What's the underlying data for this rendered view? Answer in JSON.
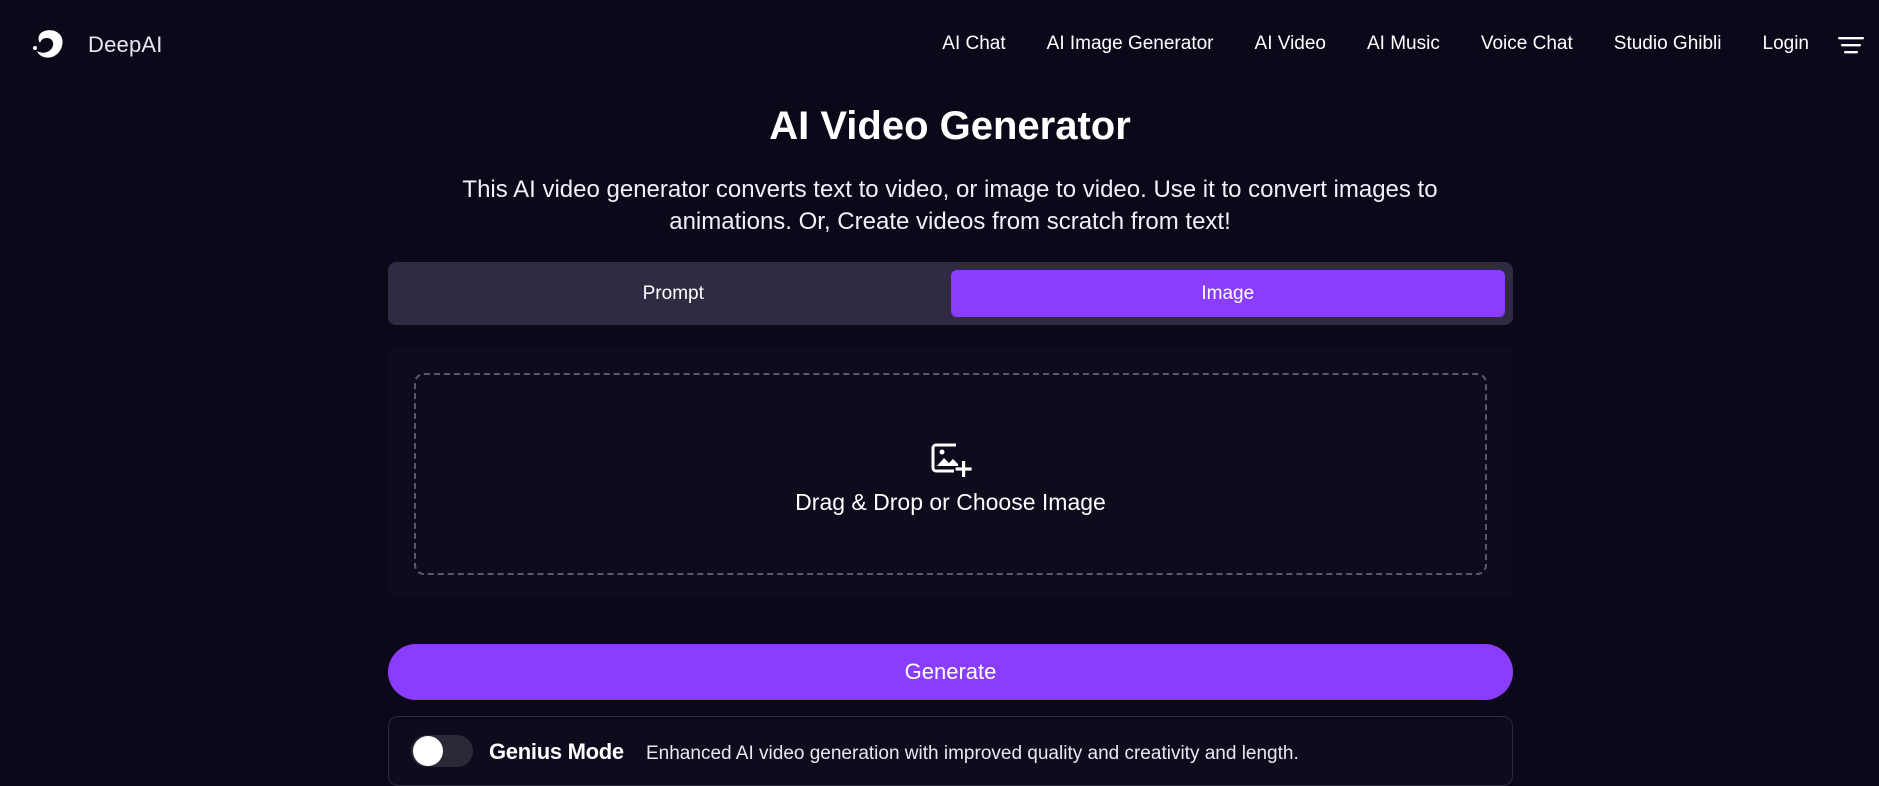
{
  "header": {
    "brand_name": "DeepAI",
    "nav_items": [
      {
        "label": "AI Chat"
      },
      {
        "label": "AI Image Generator"
      },
      {
        "label": "AI Video"
      },
      {
        "label": "AI Music"
      },
      {
        "label": "Voice Chat"
      },
      {
        "label": "Studio Ghibli"
      },
      {
        "label": "Login"
      }
    ],
    "menu_icon": "hamburger-menu-icon"
  },
  "main": {
    "title": "AI Video Generator",
    "description": "This AI video generator converts text to video, or image to video. Use it to convert images to animations. Or, Create videos from scratch from text!",
    "tabs": [
      {
        "label": "Prompt",
        "active": false
      },
      {
        "label": "Image",
        "active": true
      }
    ],
    "upload": {
      "icon": "add-image-icon",
      "text": "Drag & Drop or Choose Image"
    },
    "generate_label": "Generate",
    "genius": {
      "label": "Genius Mode",
      "description": "Enhanced AI video generation with improved quality and creativity and length.",
      "enabled": false
    }
  },
  "colors": {
    "background": "#0b0819",
    "accent": "#8b3dff",
    "tab_track": "#302b42",
    "panel": "#0e0b1d"
  }
}
